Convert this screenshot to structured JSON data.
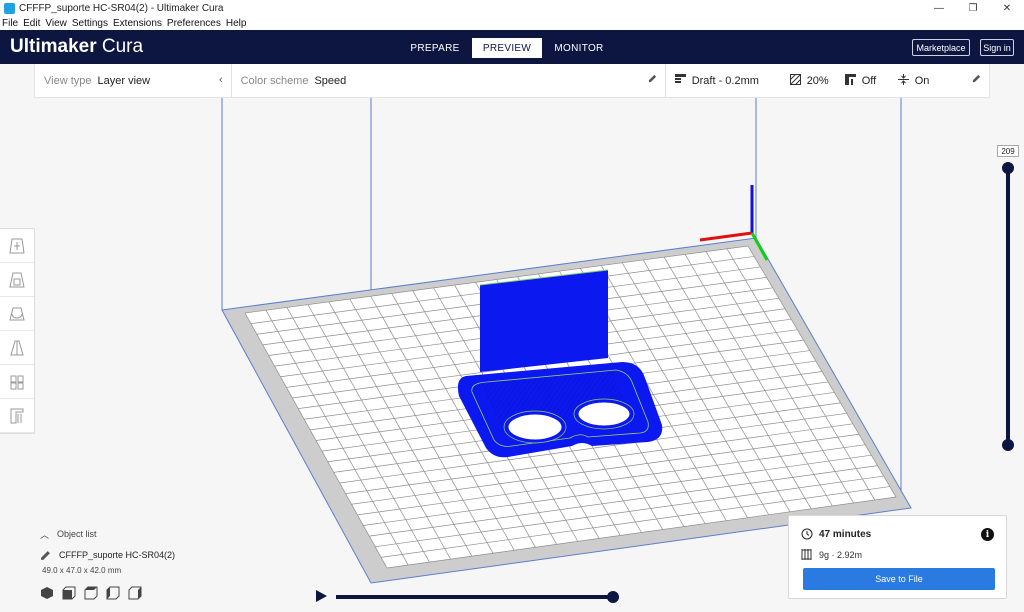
{
  "window": {
    "title": "CFFFP_suporte HC-SR04(2) - Ultimaker Cura",
    "minimize": "—",
    "restore": "❐",
    "close": "✕"
  },
  "menu": [
    "File",
    "Edit",
    "View",
    "Settings",
    "Extensions",
    "Preferences",
    "Help"
  ],
  "header": {
    "logo_bold": "Ultimaker",
    "logo_light": " Cura",
    "stages": [
      {
        "label": "PREPARE",
        "active": false
      },
      {
        "label": "PREVIEW",
        "active": true
      },
      {
        "label": "MONITOR",
        "active": false
      }
    ],
    "marketplace": "Marketplace",
    "signin": "Sign in"
  },
  "stage_menu": {
    "view_type_label": "View type",
    "view_type_value": "Layer view",
    "color_scheme_label": "Color scheme",
    "color_scheme_value": "Speed",
    "profile": "Draft - 0.2mm",
    "infill": "20%",
    "support": "Off",
    "adhesion": "On"
  },
  "layer_slider": {
    "current_layer": "209",
    "value_fraction": 1.0
  },
  "object_panel": {
    "object_list_label": "Object list",
    "object_name": "CFFFP_suporte HC-SR04(2)",
    "dimensions": "49.0 x 47.0 x 42.0 mm"
  },
  "print_info": {
    "time": "47 minutes",
    "material": "9g · 2.92m",
    "save_button": "Save to File"
  },
  "simulation": {
    "progress_fraction": 1.0
  },
  "colors": {
    "header_bg": "#0c1641",
    "accent": "#2a7ae2",
    "model": "#0b18f0"
  }
}
